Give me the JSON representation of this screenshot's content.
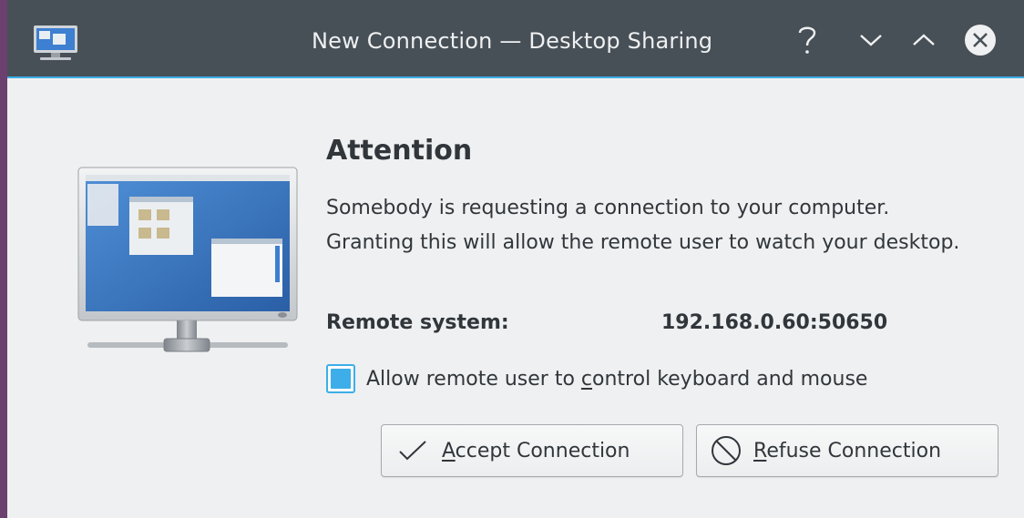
{
  "window": {
    "title": "New Connection — Desktop Sharing",
    "icon": "desktop-sharing-icon"
  },
  "titlebar_buttons": [
    {
      "name": "help",
      "icon": "question-mark-icon"
    },
    {
      "name": "minimize",
      "icon": "chevron-down-icon"
    },
    {
      "name": "maximize",
      "icon": "chevron-up-icon"
    },
    {
      "name": "close",
      "icon": "close-circle-icon"
    }
  ],
  "dialog": {
    "heading": "Attention",
    "message": "Somebody is requesting a connection to your computer. Granting this will allow the remote user to watch your desktop.",
    "remote_label": "Remote system:",
    "remote_value": "192.168.0.60:50650",
    "checkbox": {
      "before": "Allow remote user to ",
      "mnemonic": "c",
      "after": "ontrol keyboard and mouse",
      "checked": true
    },
    "accept_button": {
      "mnemonic": "A",
      "rest": "ccept Connection",
      "icon": "checkmark-icon"
    },
    "refuse_button": {
      "mnemonic": "R",
      "rest": "efuse Connection",
      "icon": "no-entry-icon"
    }
  },
  "colors": {
    "titlebar": "#475057",
    "accent": "#3daee9",
    "window_bg": "#eff0f1",
    "text": "#31363b"
  }
}
